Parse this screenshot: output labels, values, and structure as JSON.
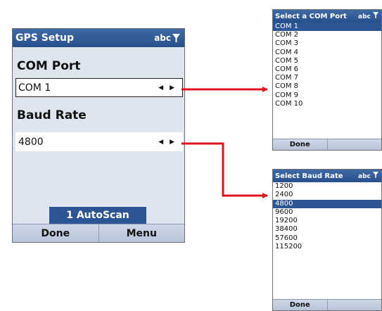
{
  "main": {
    "title": "GPS Setup",
    "input_indicator": "abc",
    "com_label": "COM Port",
    "com_value": "COM 1",
    "baud_label": "Baud Rate",
    "baud_value": "4800",
    "arrows": "◀ ▶",
    "autoscan_label": "1 AutoScan",
    "left_softkey": "Done",
    "right_softkey": "Menu"
  },
  "com_popup": {
    "title": "Select a COM Port",
    "input_indicator": "abc",
    "items": [
      "COM 1",
      "COM 2",
      "COM 3",
      "COM 4",
      "COM 5",
      "COM 6",
      "COM 7",
      "COM 8",
      "COM 9",
      "COM 10"
    ],
    "selected_index": 0,
    "left_softkey": "Done"
  },
  "baud_popup": {
    "title": "Select Baud Rate",
    "input_indicator": "abc",
    "items": [
      "1200",
      "2400",
      "4800",
      "9600",
      "19200",
      "38400",
      "57600",
      "115200"
    ],
    "selected_index": 2,
    "left_softkey": "Done"
  },
  "colors": {
    "titlebar": "#2d5594",
    "selection": "#2d5594",
    "arrow": "#e0141e",
    "screen_bg": "#dfe5ef"
  }
}
